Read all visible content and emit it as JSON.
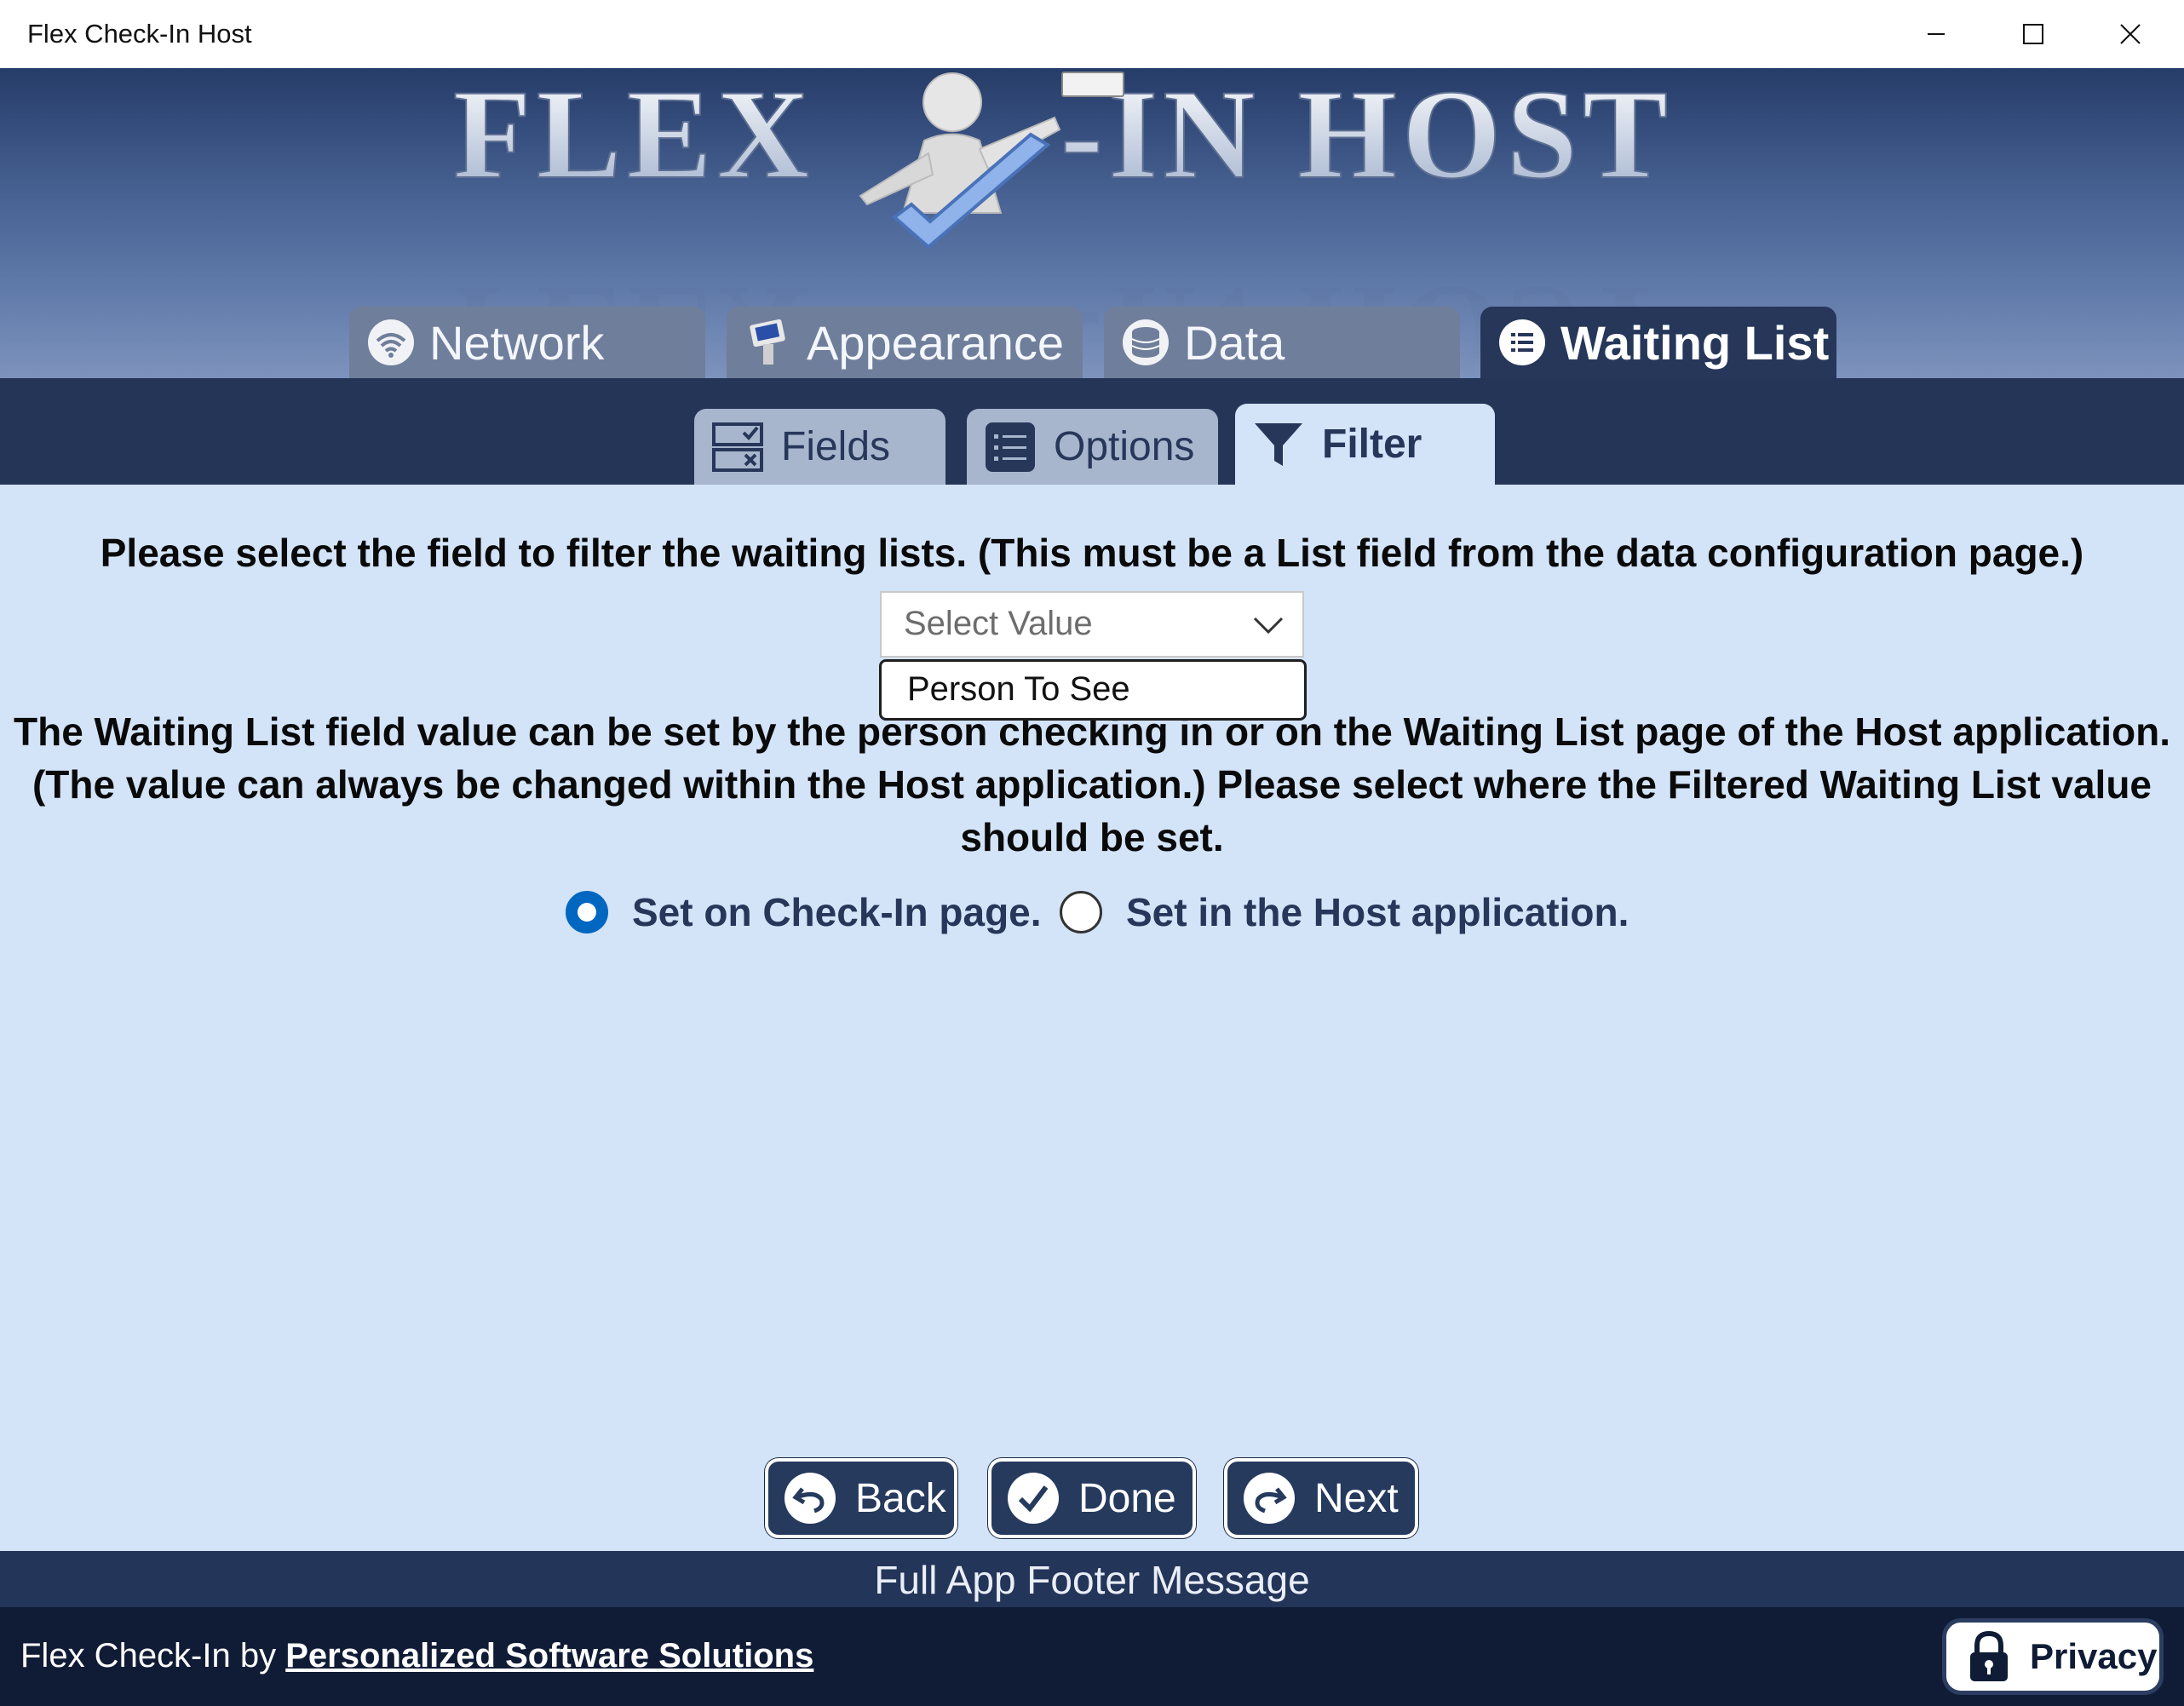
{
  "window": {
    "title": "Flex Check-In Host"
  },
  "banner": {
    "logo_text": "FLEX   -IN HOST"
  },
  "main_tabs": [
    {
      "label": "Network",
      "icon": "wifi-icon"
    },
    {
      "label": "Appearance",
      "icon": "kiosk-icon"
    },
    {
      "label": "Data",
      "icon": "database-icon"
    },
    {
      "label": "Waiting List",
      "icon": "list-icon",
      "selected": true
    }
  ],
  "sub_tabs": [
    {
      "label": "Fields",
      "icon": "fields-icon"
    },
    {
      "label": "Options",
      "icon": "options-list-icon"
    },
    {
      "label": "Filter",
      "icon": "filter-icon",
      "selected": true
    }
  ],
  "filter": {
    "instruction": "Please select the field to filter the waiting lists.  (This must be a List field from the data configuration page.)",
    "select_placeholder": "Select Value",
    "dropdown_options": [
      "Person To See"
    ],
    "set_instruction_line1": "The Waiting List field value can be set by the person checking in or on the Waiting List page of the Host application.",
    "set_instruction_line2": "(The value can always be changed within the Host application.)  Please select where the Filtered Waiting List value",
    "set_instruction_line3": "should be set.",
    "radio_checkin_label": "Set on Check-In page.",
    "radio_host_label": "Set in the Host application.",
    "selected_option": "Set on Check-In page."
  },
  "nav": {
    "back_label": "Back",
    "done_label": "Done",
    "next_label": "Next"
  },
  "footer": {
    "message": "Full App Footer Message",
    "credit_prefix": "Flex Check-In by ",
    "credit_link": "Personalized Software Solutions",
    "privacy_label": "Privacy"
  },
  "colors": {
    "content_bg": "#d3e3f8",
    "header_dark": "#243558",
    "tab_inactive": "#6f7e9b",
    "subtab_inactive": "#a7b6cd",
    "accent_radio": "#0067c0",
    "button_bg": "#263a5e",
    "bottom_bar": "#101c36"
  }
}
